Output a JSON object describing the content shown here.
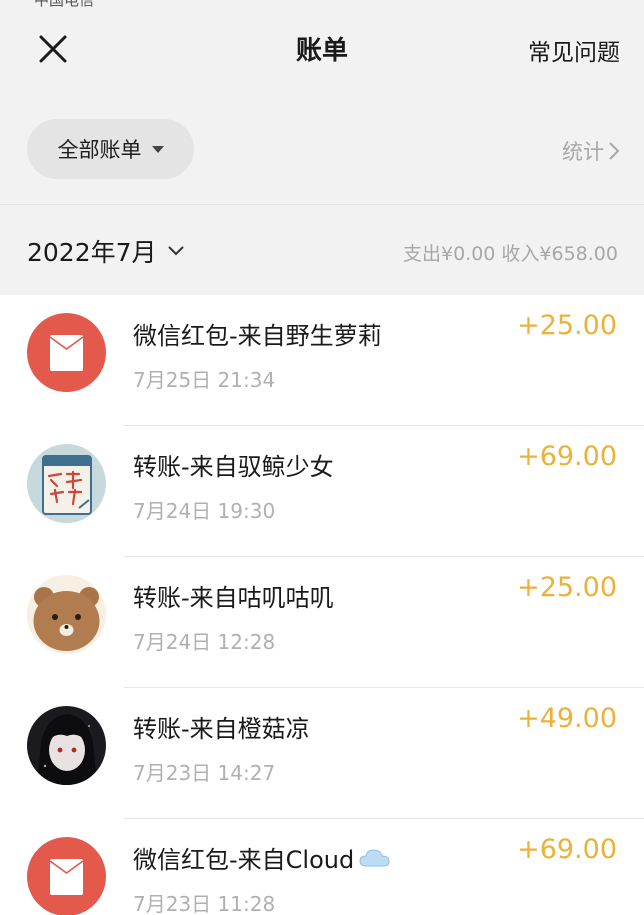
{
  "status_bar": {
    "text": "中国电信"
  },
  "header": {
    "title": "账单",
    "faq_label": "常见问题"
  },
  "filter": {
    "label": "全部账单",
    "stats_label": "统计"
  },
  "month": {
    "label": "2022年7月",
    "summary": "支出¥0.00 收入¥658.00"
  },
  "transactions": [
    {
      "title": "微信红包-来自野生萝莉",
      "time": "7月25日 21:34",
      "amount": "+25.00",
      "avatar": "red-packet-icon"
    },
    {
      "title": "转账-来自驭鲸少女",
      "time": "7月24日 19:30",
      "amount": "+69.00",
      "avatar": "exam-sign-avatar"
    },
    {
      "title": "转账-来自咕叽咕叽",
      "time": "7月24日 12:28",
      "amount": "+25.00",
      "avatar": "bear-avatar"
    },
    {
      "title": "转账-来自橙菇凉",
      "time": "7月23日 14:27",
      "amount": "+49.00",
      "avatar": "anime-girl-avatar"
    },
    {
      "title": "微信红包-来自Cloud",
      "time": "7月23日 11:28",
      "amount": "+69.00",
      "avatar": "red-packet-icon",
      "title_icon": "cloud-icon"
    }
  ],
  "colors": {
    "background": "#f2f2f2",
    "list_background": "#ffffff",
    "amount": "#eab23a",
    "red_packet": "#e35a4c",
    "secondary_text": "#a8a8a8"
  }
}
